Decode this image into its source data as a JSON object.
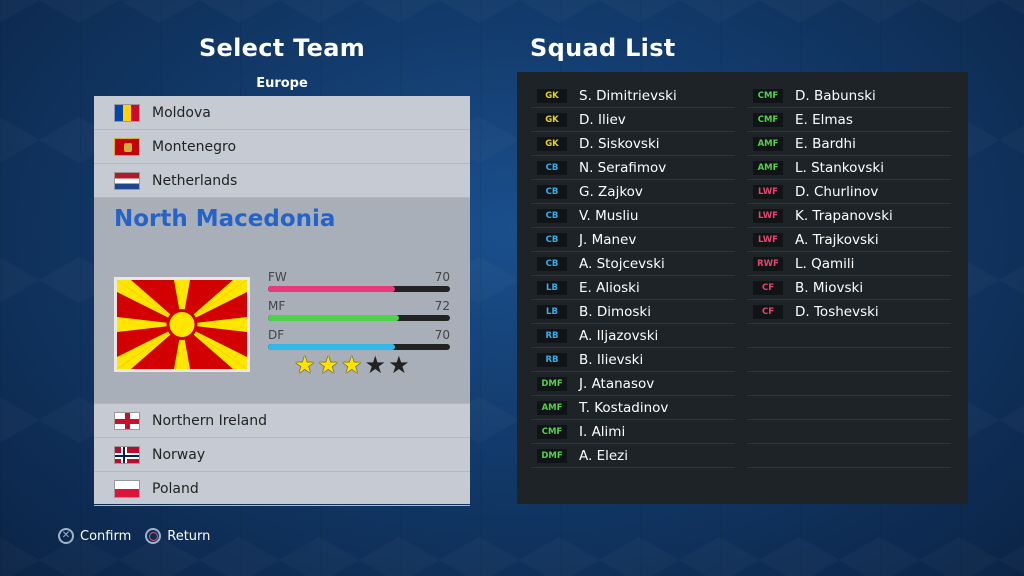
{
  "left": {
    "title": "Select Team",
    "region": "Europe",
    "teams_above": [
      {
        "name": "Moldova",
        "flag": "flag-md"
      },
      {
        "name": "Montenegro",
        "flag": "flag-me"
      },
      {
        "name": "Netherlands",
        "flag": "flag-nl"
      }
    ],
    "selected": {
      "name": "North Macedonia",
      "stats": [
        {
          "label": "FW",
          "value": "70",
          "color": "#e8397a",
          "fill": 0.7
        },
        {
          "label": "MF",
          "value": "72",
          "color": "#4fd14b",
          "fill": 0.72
        },
        {
          "label": "DF",
          "value": "70",
          "color": "#32b9ea",
          "fill": 0.7
        }
      ],
      "stars": 3,
      "stars_max": 5
    },
    "teams_below": [
      {
        "name": "Northern Ireland",
        "flag": "flag-ni"
      },
      {
        "name": "Norway",
        "flag": "flag-no"
      },
      {
        "name": "Poland",
        "flag": "flag-pl"
      }
    ]
  },
  "hints": {
    "confirm": "Confirm",
    "return": "Return"
  },
  "right": {
    "title": "Squad List",
    "position_colors": {
      "GK": "#e6d11f",
      "CB": "#3aaee6",
      "LB": "#3aaee6",
      "RB": "#3aaee6",
      "DMF": "#55d14b",
      "CMF": "#55d14b",
      "AMF": "#55d14b",
      "LWF": "#e8456b",
      "RWF": "#e8456b",
      "CF": "#e8456b"
    },
    "col1": [
      {
        "pos": "GK",
        "name": "S. Dimitrievski"
      },
      {
        "pos": "GK",
        "name": "D. Iliev"
      },
      {
        "pos": "GK",
        "name": "D. Siskovski"
      },
      {
        "pos": "CB",
        "name": "N. Serafimov"
      },
      {
        "pos": "CB",
        "name": "G. Zajkov"
      },
      {
        "pos": "CB",
        "name": "V. Musliu"
      },
      {
        "pos": "CB",
        "name": "J. Manev"
      },
      {
        "pos": "CB",
        "name": "A. Stojcevski"
      },
      {
        "pos": "LB",
        "name": "E. Alioski"
      },
      {
        "pos": "LB",
        "name": "B. Dimoski"
      },
      {
        "pos": "RB",
        "name": "A. Iljazovski"
      },
      {
        "pos": "RB",
        "name": "B. Ilievski"
      },
      {
        "pos": "DMF",
        "name": "J. Atanasov"
      },
      {
        "pos": "AMF",
        "name": "T. Kostadinov"
      },
      {
        "pos": "CMF",
        "name": "I. Alimi"
      },
      {
        "pos": "DMF",
        "name": "A. Elezi"
      }
    ],
    "col2": [
      {
        "pos": "CMF",
        "name": "D. Babunski"
      },
      {
        "pos": "CMF",
        "name": "E. Elmas"
      },
      {
        "pos": "AMF",
        "name": "E. Bardhi"
      },
      {
        "pos": "AMF",
        "name": "L. Stankovski"
      },
      {
        "pos": "LWF",
        "name": "D. Churlinov"
      },
      {
        "pos": "LWF",
        "name": "K. Trapanovski"
      },
      {
        "pos": "LWF",
        "name": "A. Trajkovski"
      },
      {
        "pos": "RWF",
        "name": "L. Qamili"
      },
      {
        "pos": "CF",
        "name": "B. Miovski"
      },
      {
        "pos": "CF",
        "name": "D. Toshevski"
      },
      {
        "pos": "",
        "name": ""
      },
      {
        "pos": "",
        "name": ""
      },
      {
        "pos": "",
        "name": ""
      },
      {
        "pos": "",
        "name": ""
      },
      {
        "pos": "",
        "name": ""
      },
      {
        "pos": "",
        "name": ""
      }
    ]
  }
}
